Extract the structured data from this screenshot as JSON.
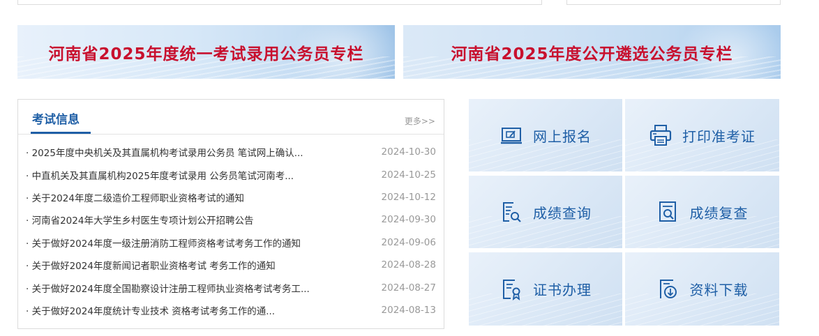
{
  "banners": [
    {
      "label": "河南省2025年度统一考试录用公务员专栏"
    },
    {
      "label": "河南省2025年度公开遴选公务员专栏"
    }
  ],
  "news": {
    "title": "考试信息",
    "more": "更多>>",
    "items": [
      {
        "title": "· 2025年度中央机关及其直属机构考试录用公务员 笔试网上确认...",
        "date": "2024-10-30"
      },
      {
        "title": "· 中直机关及其直属机构2025年度考试录用 公务员笔试河南考...",
        "date": "2024-10-25"
      },
      {
        "title": "· 关于2024年度二级造价工程师职业资格考试的通知",
        "date": "2024-10-12"
      },
      {
        "title": "· 河南省2024年大学生乡村医生专项计划公开招聘公告",
        "date": "2024-09-30"
      },
      {
        "title": "· 关于做好2024年度一级注册消防工程师资格考试考务工作的通知",
        "date": "2024-09-06"
      },
      {
        "title": "· 关于做好2024年度新闻记者职业资格考试 考务工作的通知",
        "date": "2024-08-28"
      },
      {
        "title": "· 关于做好2024年度全国勘察设计注册工程师执业资格考试考务工...",
        "date": "2024-08-27"
      },
      {
        "title": "· 关于做好2024年度统计专业技术 资格考试考务工作的通...",
        "date": "2024-08-13"
      }
    ]
  },
  "services": [
    {
      "label": "网上报名",
      "icon": "online-registration-icon"
    },
    {
      "label": "打印准考证",
      "icon": "printer-icon"
    },
    {
      "label": "成绩查询",
      "icon": "score-query-icon"
    },
    {
      "label": "成绩复查",
      "icon": "score-review-icon"
    },
    {
      "label": "证书办理",
      "icon": "certificate-icon"
    },
    {
      "label": "资料下载",
      "icon": "download-icon"
    }
  ],
  "colors": {
    "accent_blue": "#1f5fa6",
    "banner_red": "#c8102e",
    "date_gray": "#999999"
  }
}
